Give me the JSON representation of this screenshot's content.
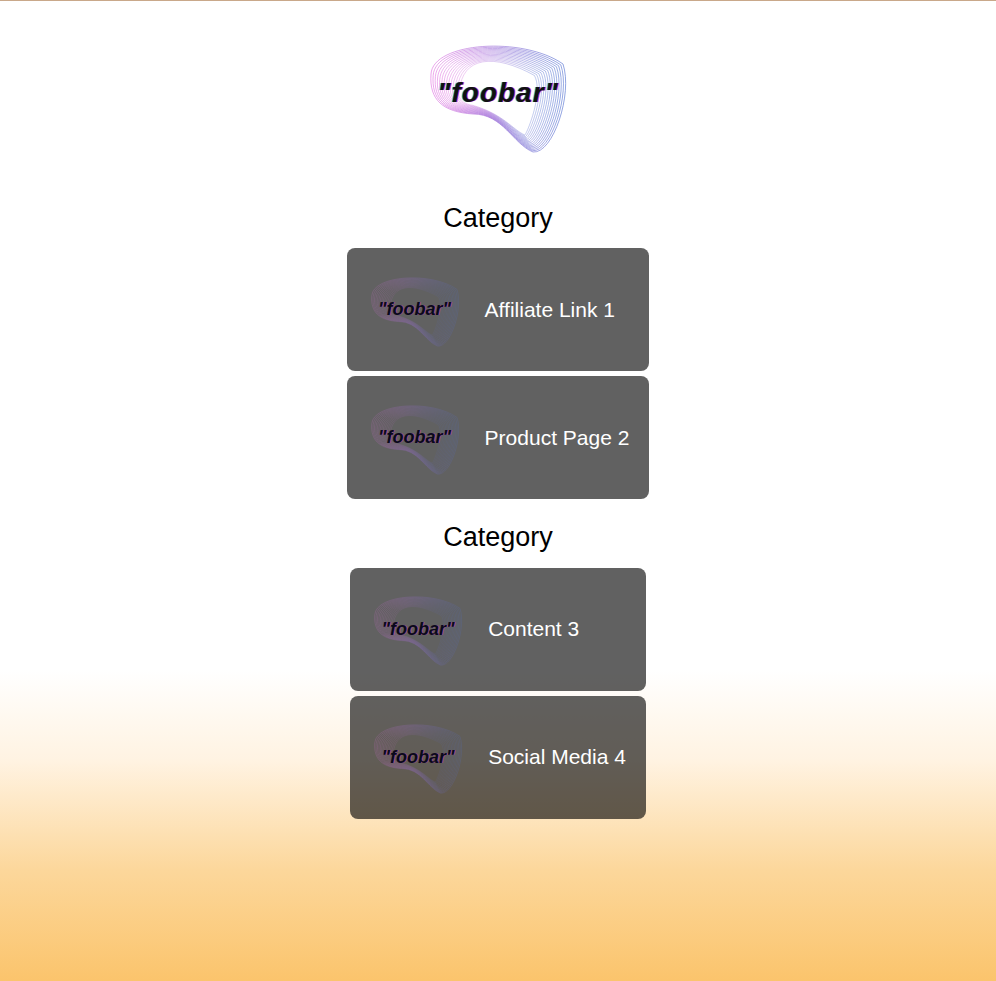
{
  "logo": {
    "text": "\"foobar\""
  },
  "groups": [
    {
      "heading": "Category",
      "links": [
        {
          "thumbnail": "\"foobar\"",
          "label": "Affiliate Link 1"
        },
        {
          "thumbnail": "\"foobar\"",
          "label": "Product Page 2"
        }
      ]
    },
    {
      "heading": "Category",
      "links": [
        {
          "thumbnail": "\"foobar\"",
          "label": "Content 3"
        },
        {
          "thumbnail": "\"foobar\"",
          "label": "Social Media 4"
        }
      ]
    }
  ]
}
